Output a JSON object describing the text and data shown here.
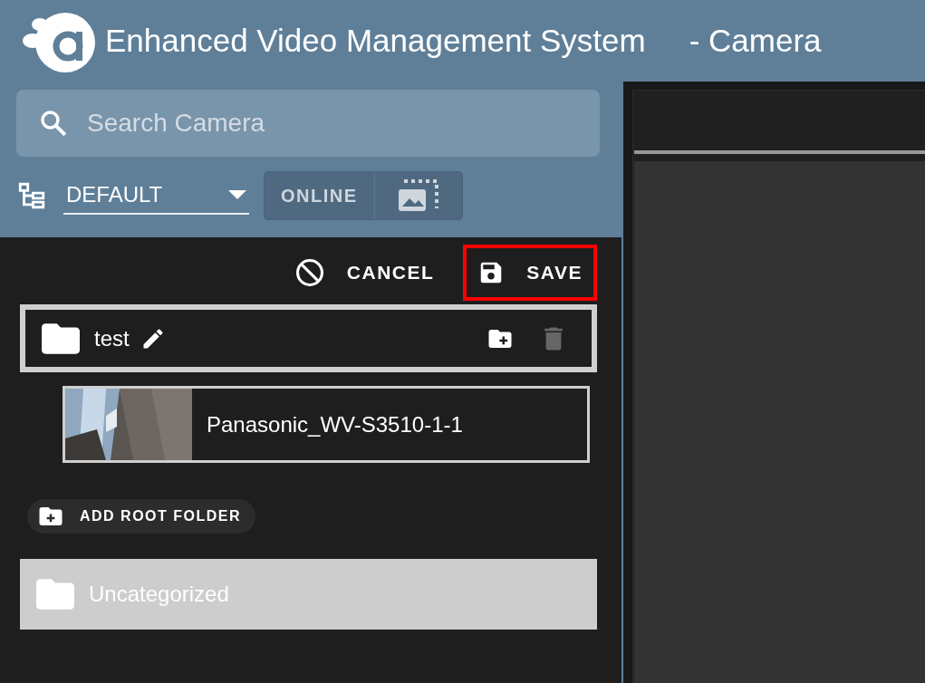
{
  "header": {
    "title": "Enhanced Video Management System",
    "subtitle": "- Camera"
  },
  "search": {
    "placeholder": "Search Camera"
  },
  "group_selector": {
    "value": "DEFAULT"
  },
  "filter_toggle": {
    "label": "ONLINE"
  },
  "toolbar": [
    {
      "kind": "cancel",
      "label": "CANCEL",
      "highlighted": false
    },
    {
      "kind": "save",
      "label": "SAVE",
      "highlighted": true
    }
  ],
  "folders": [
    {
      "name": "test",
      "selected": true,
      "delete_disabled": true,
      "children": [
        {
          "name": "Panasonic_WV-S3510-1-1",
          "kind": "camera"
        }
      ]
    }
  ],
  "add_root_folder": {
    "label": "ADD ROOT FOLDER"
  },
  "uncategorized": {
    "name": "Uncategorized"
  }
}
